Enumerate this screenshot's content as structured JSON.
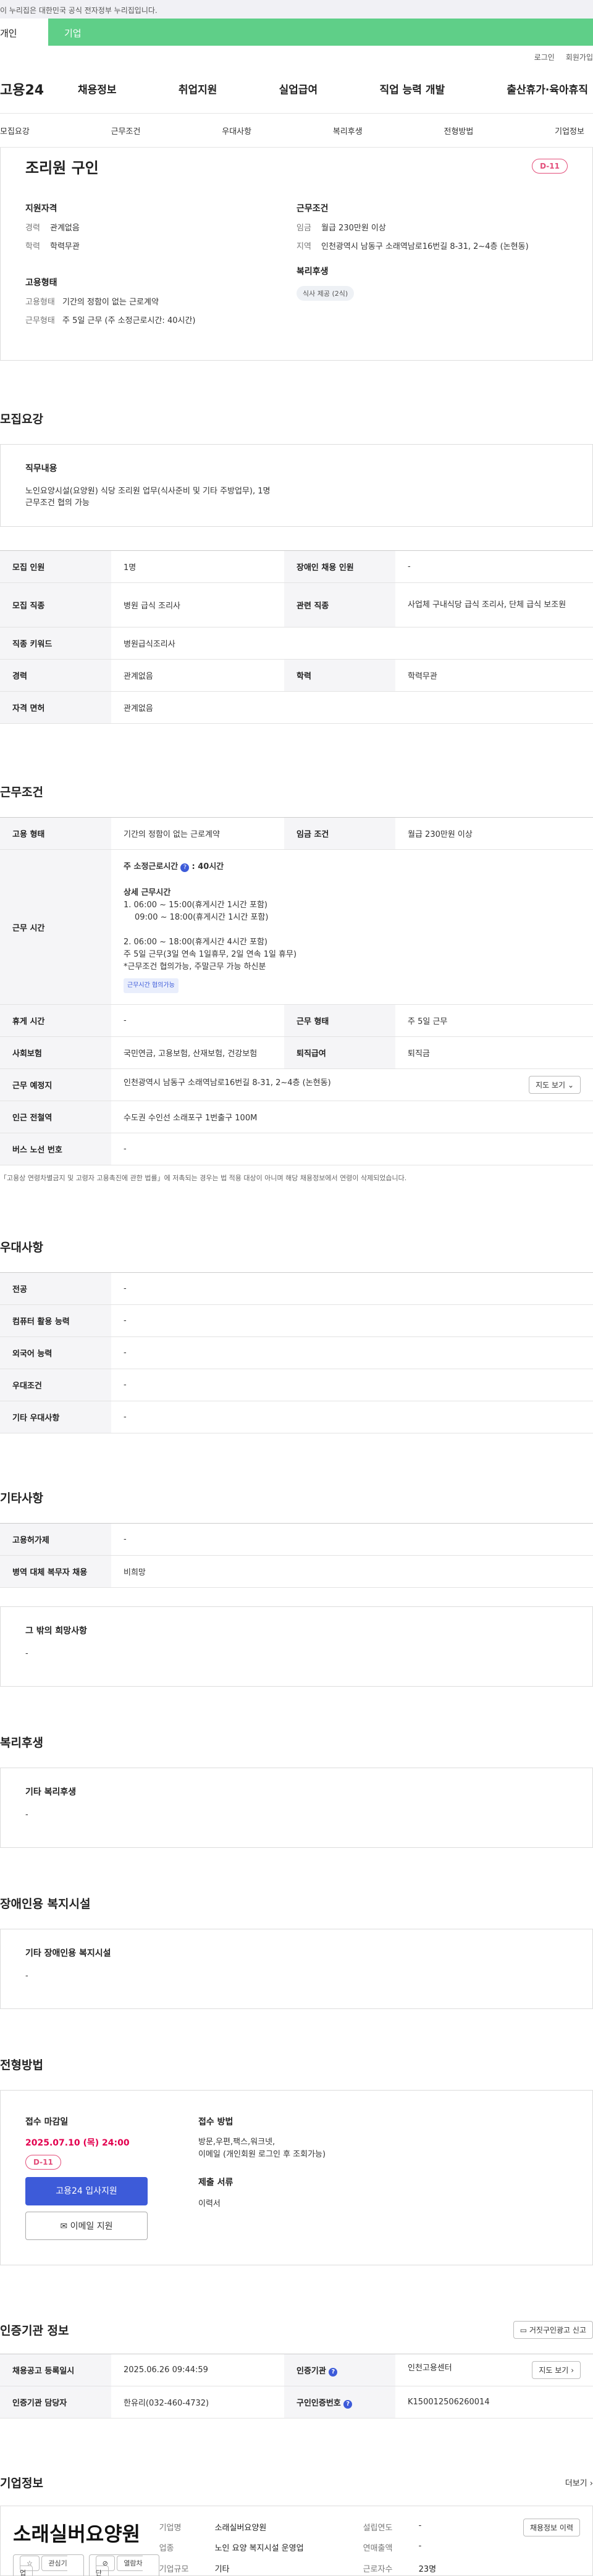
{
  "gov_banner": "이 누리집은 대한민국 공식 전자정부 누리집입니다.",
  "user_tabs": [
    "개인",
    "기업"
  ],
  "util_links": [
    "로그인",
    "회원가입"
  ],
  "logo": "고용24",
  "gnb": [
    "채용정보",
    "취업지원",
    "실업급여",
    "직업 능력 개발",
    "출산휴가·육아휴직"
  ],
  "subnav": [
    "모집요강",
    "근무조건",
    "우대사항",
    "복리후생",
    "전형방법",
    "기업정보"
  ],
  "summary": {
    "title": "조리원 구인",
    "dday": "D-11",
    "qual_title": "지원자격",
    "career_k": "경력",
    "career_v": "관계없음",
    "edu_k": "학력",
    "edu_v": "학력무관",
    "emp_title": "고용형태",
    "emptype_k": "고용형태",
    "emptype_v": "기간의 정함이 없는 근로계약",
    "worktype_k": "근무형태",
    "worktype_v": "주 5일 근무 (주 소정근로시간: 40시간)",
    "cond_title": "근무조건",
    "wage_k": "임금",
    "wage_v": "월급 230만원 이상",
    "loc_k": "지역",
    "loc_v": "인천광역시 남동구 소래역남로16번길 8-31, 2~4층 (논현동)",
    "welfare_title": "복리후생",
    "welfare_chip": "식사 제공 (2식)"
  },
  "recruit": {
    "title": "모집요강",
    "duty_title": "직무내용",
    "duty_text": "노인요양시설(요양원) 식당 조리원 업무(식사준비 및 기타 주방업무), 1명",
    "duty_text2": "근무조건 협의 가능",
    "rows": {
      "count_k": "모집 인원",
      "count_v": "1명",
      "disabled_k": "장애인 채용 인원",
      "disabled_v": "-",
      "job_k": "모집 직종",
      "job_v": "병원 급식 조리사",
      "rel_k": "관련 직종",
      "rel_v": "사업체 구내식당 급식 조리사, 단체 급식 보조원",
      "kw_k": "직종 키워드",
      "kw_v": "병원급식조리사",
      "career_k": "경력",
      "career_v": "관계없음",
      "edu_k": "학력",
      "edu_v": "학력무관",
      "lic_k": "자격 면허",
      "lic_v": "관계없음"
    }
  },
  "work": {
    "title": "근무조건",
    "emptype_k": "고용 형태",
    "emptype_v": "기간의 정함이 없는 근로계약",
    "wage_k": "임금 조건",
    "wage_v": "월급 230만원 이상",
    "time_k": "근무 시간",
    "time_weekly": "주 소정근로시간",
    "time_weekly_v": ": 40시간",
    "time_detail_title": "상세 근무시간",
    "time_l1": "1. 06:00 ~ 15:00(휴게시간 1시간 포함)",
    "time_l2": "09:00 ~ 18:00(휴게시간 1시간 포함)",
    "time_l3": "2. 06:00 ~ 18:00(휴게시간 4시간 포함)",
    "time_l4": "주 5일 근무(3일 연속 1일휴무, 2일 연속 1일 휴무)",
    "time_l5": "*근무조건 협의가능, 주말근무 가능 하신분",
    "time_chip": "근무시간 협의가능",
    "rest_k": "휴게 시간",
    "rest_v": "-",
    "form_k": "근무 형태",
    "form_v": "주 5일 근무",
    "ins_k": "사회보험",
    "ins_v": "국민연금, 고용보험, 산재보험, 건강보험",
    "sev_k": "퇴직급여",
    "sev_v": "퇴직금",
    "place_k": "근무 예정지",
    "place_v": "인천광역시 남동구 소래역남로16번길 8-31, 2~4층 (논현동)",
    "map_btn": "지도 보기",
    "station_k": "인근 전철역",
    "station_v": "수도권 수인선 소래포구 1번출구 100M",
    "bus_k": "버스 노선 번호",
    "bus_v": "-",
    "note": "「고용상 연령차별금지 및 고령자 고용촉진에 관한 법률」에 저촉되는 경우는 법 적용 대상이 아니며 해당 채용정보에서 연령이 삭제되었습니다."
  },
  "pref": {
    "title": "우대사항",
    "major_k": "전공",
    "major_v": "-",
    "pc_k": "컴퓨터 활용 능력",
    "pc_v": "-",
    "lang_k": "외국어 능력",
    "lang_v": "-",
    "cond_k": "우대조건",
    "cond_v": "-",
    "etc_k": "기타 우대사항",
    "etc_v": "-"
  },
  "other": {
    "title": "기타사항",
    "permit_k": "고용허가제",
    "permit_v": "-",
    "military_k": "병역 대체 복무자 채용",
    "military_v": "비희망",
    "hope_title": "그 밖의 희망사항",
    "hope_v": "-"
  },
  "welfare": {
    "title": "복리후생",
    "etc_title": "기타 복리후생",
    "etc_v": "-"
  },
  "disabled": {
    "title": "장애인용 복지시설",
    "etc_title": "기타 장애인용 복지시설",
    "etc_v": "-"
  },
  "apply": {
    "title": "전형방법",
    "deadline_title": "접수 마감일",
    "deadline": "2025.07.10 (목) 24:00",
    "dday": "D-11",
    "btn_apply": "고용24 입사지원",
    "btn_email": "이메일 지원",
    "method_title": "접수 방법",
    "method_v1": "방문,우편,팩스,워크넷,",
    "method_v2": "이메일 (개인회원 로그인 후 조회가능)",
    "docs_title": "제출 서류",
    "docs_v": "이력서"
  },
  "cert": {
    "title": "인증기관 정보",
    "report_btn": "거짓구인광고 신고",
    "reg_k": "채용공고 등록일시",
    "reg_v": "2025.06.26 09:44:59",
    "agency_k": "인증기관",
    "agency_v": "인천고용센터",
    "map_btn": "지도 보기",
    "manager_k": "인증기관 담당자",
    "manager_v": "한유리(032-460-4732)",
    "no_k": "구인인증번호",
    "no_v": "K150012506260014"
  },
  "company": {
    "title": "기업정보",
    "more": "더보기",
    "logo_text": "소래실버요양원",
    "fav_btn": "관심기업",
    "block_btn": "열람차단",
    "name_k": "기업명",
    "name_v": "소래실버요양원",
    "industry_k": "업종",
    "industry_v": "노인 요양 복지시설 운영업",
    "size_k": "기업규모",
    "size_v": "기타",
    "founded_k": "설립연도",
    "founded_v": "-",
    "sales_k": "연매출액",
    "sales_v": "-",
    "staff_k": "근로자수",
    "staff_v": "23명",
    "history_btn": "채용정보 이력"
  }
}
